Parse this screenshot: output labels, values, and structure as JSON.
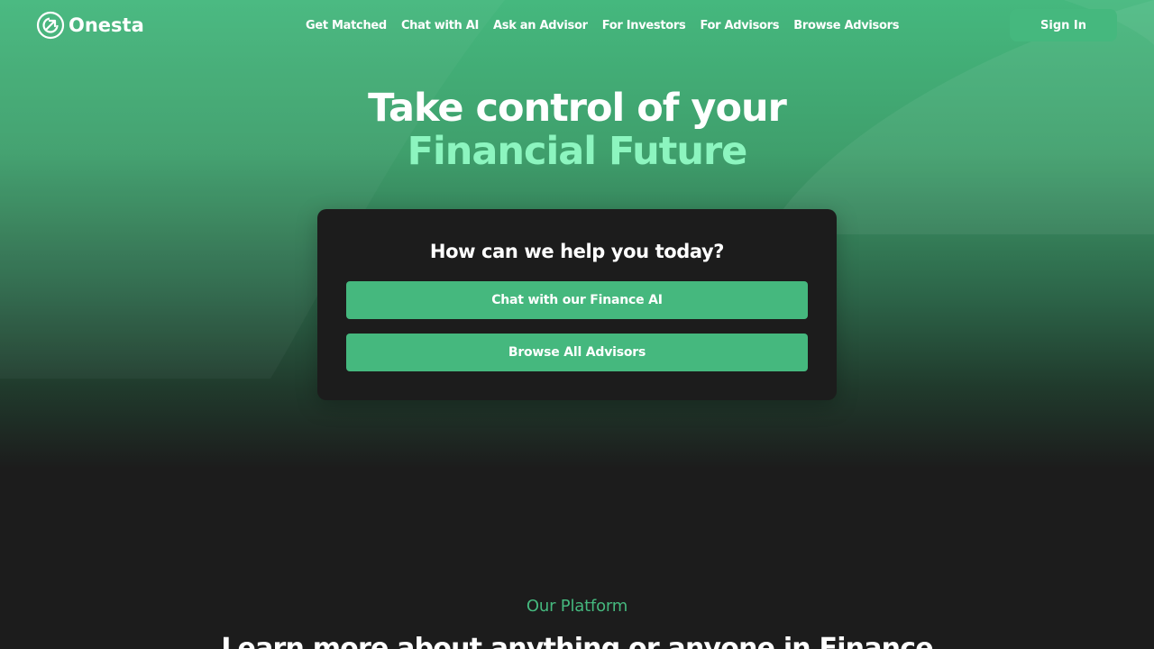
{
  "brand": {
    "name": "Onesta",
    "logo_icon": "onesta-logo-icon"
  },
  "nav": {
    "items": [
      {
        "label": "Get Matched"
      },
      {
        "label": "Chat with AI"
      },
      {
        "label": "Ask an Advisor"
      },
      {
        "label": "For Investors"
      },
      {
        "label": "For Advisors"
      },
      {
        "label": "Browse Advisors"
      }
    ],
    "signin_label": "Sign In"
  },
  "hero": {
    "title_line1": "Take control of your",
    "title_line2": "Financial Future"
  },
  "help_card": {
    "title": "How can we help you today?",
    "primary_button": "Chat with our Finance AI",
    "secondary_button": "Browse All Advisors"
  },
  "platform": {
    "eyebrow": "Our Platform",
    "title": "Learn more about anything or anyone in Finance"
  },
  "colors": {
    "accent_green": "#45b87e",
    "highlight_green": "#8cf5bf",
    "dark_background": "#1c1c1c"
  }
}
